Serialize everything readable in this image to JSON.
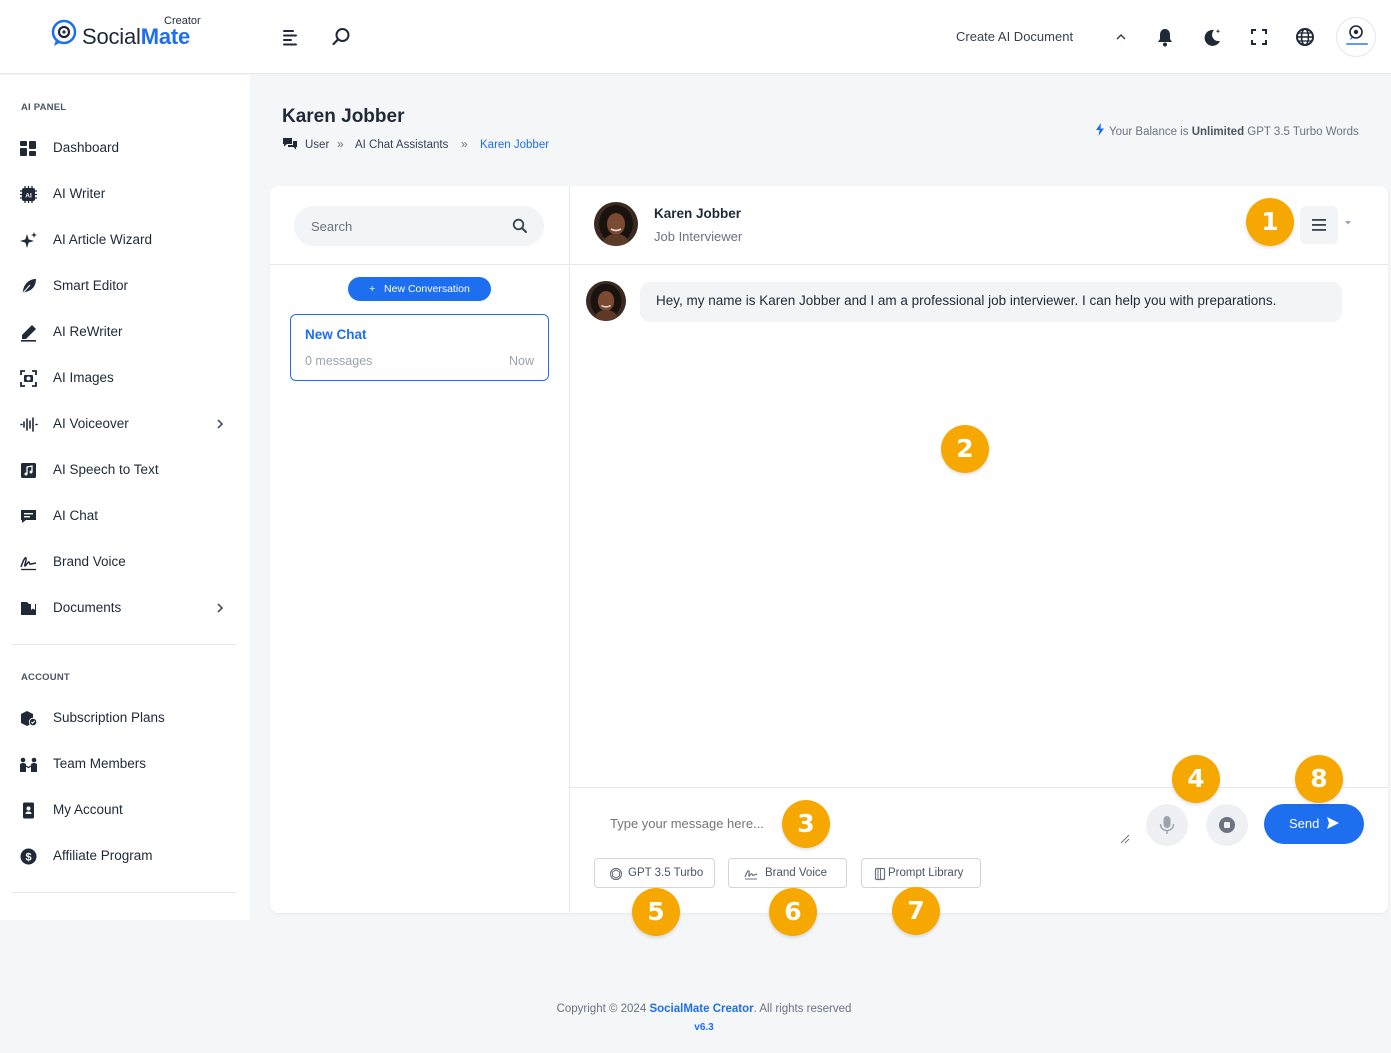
{
  "brand": {
    "creator_tag": "Creator",
    "name_part1": "Social",
    "name_part2": "Mate",
    "accent_color": "#1e6ef0"
  },
  "header": {
    "create_doc_label": "Create AI Document",
    "icons": [
      "menu-icon",
      "search-icon",
      "chevron-up-icon",
      "bell-icon",
      "moon-icon",
      "fullscreen-icon",
      "globe-icon",
      "user-avatar"
    ]
  },
  "sidebar": {
    "section_ai": "AI PANEL",
    "ai_items": [
      {
        "label": "Dashboard",
        "icon": "dashboard-icon"
      },
      {
        "label": "AI Writer",
        "icon": "ai-chip-icon"
      },
      {
        "label": "AI Article Wizard",
        "icon": "sparkles-icon"
      },
      {
        "label": "Smart Editor",
        "icon": "feather-icon"
      },
      {
        "label": "AI ReWriter",
        "icon": "pencil-icon"
      },
      {
        "label": "AI Images",
        "icon": "image-scan-icon"
      },
      {
        "label": "AI Voiceover",
        "icon": "waveform-icon",
        "has_children": true
      },
      {
        "label": "AI Speech to Text",
        "icon": "audio-file-icon"
      },
      {
        "label": "AI Chat",
        "icon": "chat-icon"
      },
      {
        "label": "Brand Voice",
        "icon": "signature-icon"
      },
      {
        "label": "Documents",
        "icon": "folder-icon",
        "has_children": true
      }
    ],
    "section_account": "ACCOUNT",
    "account_items": [
      {
        "label": "Subscription Plans",
        "icon": "box-check-icon"
      },
      {
        "label": "Team Members",
        "icon": "team-icon"
      },
      {
        "label": "My Account",
        "icon": "id-card-icon"
      },
      {
        "label": "Affiliate Program",
        "icon": "dollar-circle-icon"
      }
    ]
  },
  "page": {
    "title": "Karen Jobber",
    "breadcrumb": [
      "User",
      "AI Chat Assistants",
      "Karen Jobber"
    ],
    "balance_prefix": "Your Balance is",
    "balance_value": "Unlimited",
    "balance_suffix": "GPT 3.5 Turbo Words"
  },
  "conversations": {
    "search_placeholder": "Search",
    "new_button": "New Conversation",
    "items": [
      {
        "title": "New Chat",
        "meta": "0 messages",
        "time": "Now",
        "active": true
      }
    ]
  },
  "chat": {
    "assistant_name": "Karen Jobber",
    "assistant_role": "Job Interviewer",
    "messages": [
      {
        "from": "assistant",
        "text": "Hey, my name is Karen Jobber and I am a professional job interviewer. I can help you with preparations."
      }
    ],
    "input_placeholder": "Type your message here...",
    "send_label": "Send",
    "chips": [
      {
        "label": "GPT 3.5 Turbo",
        "icon": "openai-icon"
      },
      {
        "label": "Brand Voice",
        "icon": "signature-icon"
      },
      {
        "label": "Prompt Library",
        "icon": "book-icon"
      }
    ]
  },
  "annotations": [
    "1",
    "2",
    "3",
    "4",
    "5",
    "6",
    "7",
    "8"
  ],
  "annotation_color": "#f7a800",
  "footer": {
    "prefix": "Copyright © 2024",
    "brand": "SocialMate Creator",
    "suffix": ". All rights reserved",
    "version": "v6.3"
  }
}
